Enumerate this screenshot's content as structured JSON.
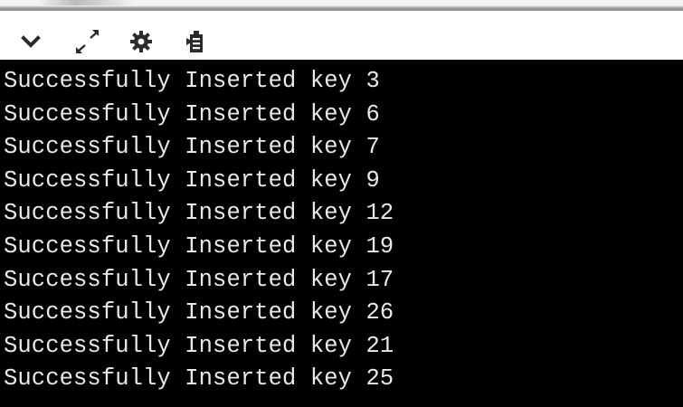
{
  "toolbar": {
    "icons": [
      {
        "name": "chevron-down-icon",
        "label": "collapse"
      },
      {
        "name": "expand-icon",
        "label": "expand"
      },
      {
        "name": "gear-icon",
        "label": "settings"
      },
      {
        "name": "stdin-icon",
        "label": "input"
      }
    ]
  },
  "console": {
    "lines": [
      "Successfully Inserted key 3",
      "Successfully Inserted key 6",
      "Successfully Inserted key 7",
      "Successfully Inserted key 9",
      "Successfully Inserted key 12",
      "Successfully Inserted key 19",
      "Successfully Inserted key 17",
      "Successfully Inserted key 26",
      "Successfully Inserted key 21",
      "Successfully Inserted key 25"
    ]
  },
  "colors": {
    "console_background": "#000000",
    "console_text": "#e9e9e9",
    "toolbar_background": "#ffffff",
    "icon": "#2b2b2b"
  }
}
